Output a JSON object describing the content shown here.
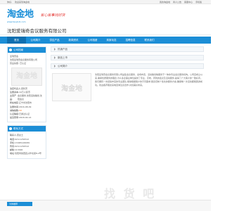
{
  "topbar": {
    "left": [
      "你好,",
      "欢迎来到淘金地"
    ],
    "right": [
      "我的淘金地",
      "商人公告",
      "客服中心",
      "手机版"
    ]
  },
  "header": {
    "logo": "淘金地",
    "logo_url": "www.taojindi.com",
    "slogan": "省心省事找好货"
  },
  "company": {
    "name": "沈阳爱瑞奇会议服务有限公司"
  },
  "nav": {
    "items": [
      "首页",
      "公司简介",
      "供应产品",
      "新闻资讯",
      "公司相册",
      "商家动态",
      "招聘信息",
      "联系我们"
    ]
  },
  "sidebar": {
    "profile_title": "公司档案",
    "profile_rows": [
      {
        "text": "爱瑞奇会"
      },
      {
        "text": "沈阳爱瑞奇会议服务有限公司"
      },
      {
        "text": "营业执照: 已认证"
      },
      {
        "label": "法定代表人:",
        "value": "唐利芳"
      },
      {
        "label": "注册资本:",
        "value": "10万人民币"
      },
      {
        "label": "主营产品:",
        "value": "会议服务,沈阳活动策划,沈阳会议"
      },
      {
        "label": "所在地区:",
        "value": "辽宁省沈阳市"
      },
      {
        "label": "注册时间:",
        "value": "2016-08-09"
      },
      {
        "label": "诚信指数:",
        "value": "10"
      },
      {
        "label": "认证等级:",
        "value": "已通过认证"
      },
      {
        "label": "最近登录:",
        "value": "2018-04-14"
      }
    ],
    "contact_title": "联系方式",
    "contact_rows": [
      {
        "label": "联系人:",
        "value": "唐女士"
      },
      {
        "label": "电话:",
        "value": "024-1234512"
      },
      {
        "label": "手机:",
        "value": "13465126089"
      },
      {
        "label": "传真:",
        "value": "024-1234512"
      },
      {
        "label": "邮箱:",
        "value": "113090"
      },
      {
        "label": "地址:",
        "value": "沈阳市铁西区兴华北街8-2号"
      }
    ]
  },
  "content": {
    "hot_products": "热销产品",
    "new_products": "新品上市",
    "intro_title": "公司简介",
    "intro_text": "沈阳爱瑞奇会议服务有限公司是集会议服务、会场布置、活动策划等服务于一体的专业会议服务机构。公司自成立以来,秉承优质服务的理念,为众多企事业单位提供了专业、高效、周到的会议及活动服务,赢得了广大客户的一致好评。我们拥有一支经验丰富的专业团队,能够根据客户的不同需求,量身定制个性化的服务方案,确保每一次活动都能圆满成功。欢迎各界朋友来电咨询洽谈合作,共创美好未来。",
    "thumb_text": "淘金地"
  },
  "watermark": "找 货 吧",
  "footer": {
    "tab": "为你推荐"
  },
  "colors": {
    "primary": "#1c8ed6",
    "accent": "#e53935",
    "highlight": "#ff6600"
  }
}
